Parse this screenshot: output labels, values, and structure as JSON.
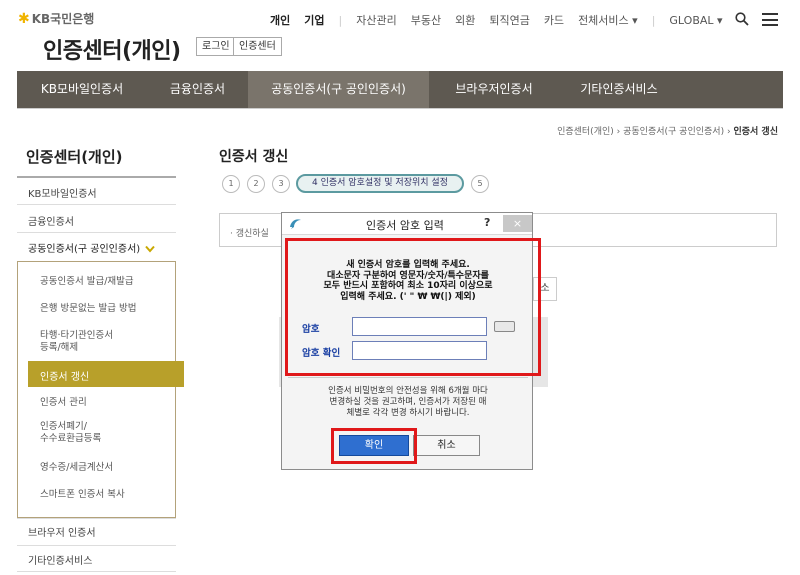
{
  "header": {
    "logo_text": "KB국민은행",
    "title": "인증센터(개인)",
    "login_label": "로그인",
    "cert_center_label": "인증센터",
    "nav": [
      "개인",
      "기업",
      "자산관리",
      "부동산",
      "외환",
      "퇴직연금",
      "카드",
      "전체서비스 ▾",
      "GLOBAL ▾"
    ]
  },
  "mainnav": [
    "KB모바일인증서",
    "금융인증서",
    "공동인증서(구 공인인증서)",
    "브라우저인증서",
    "기타인증서비스"
  ],
  "breadcrumb": {
    "items": [
      "인증센터(개인)",
      "공동인증서(구 공인인증서)"
    ],
    "current": "인증서 갱신",
    "separator": "›"
  },
  "sidebar": {
    "title": "인증센터(개인)",
    "items": [
      "KB모바일인증서",
      "금융인증서",
      "공동인증서(구 공인인증서)",
      "브라우저 인증서",
      "기타인증서비스"
    ],
    "sub_items": [
      "공동인증서 발급/재발급",
      "은행 방문없는 발급 방법",
      "타행·타기관인증서",
      "등록/해제",
      "인증서 갱신",
      "인증서 관리",
      "인증서폐기/",
      "수수료환급등록",
      "영수증/세금계산서",
      "스마트폰 인증서 복사"
    ]
  },
  "content": {
    "title": "인증서 갱신",
    "steps": [
      "1",
      "2",
      "3",
      "5"
    ],
    "active_step": "4 인증서 암호설정 및 저장위치 설정",
    "box_text": "· 갱신하실",
    "bg_button": "소"
  },
  "dialog": {
    "title": "인증서 암호 입력",
    "help": "?",
    "close": "×",
    "message_lines": [
      "새 인증서 암호를 입력해 주세요.",
      "대소문자 구분하여 영문자/숫자/특수문자를",
      "모두 반드시 포함하여 최소 10자리 이상으로",
      "입력해 주세요. (' \" ₩ ₩(|) 제외)"
    ],
    "password_label": "암호",
    "confirm_label": "암호 확인",
    "password_value": "",
    "confirm_value": "",
    "note_lines": [
      "인증서 비밀번호의 안전성을 위해 6개월 마다",
      "변경하실 것을 권고하며, 인증서가 저장된 매",
      "체별로 각각 변경 하시기 바랍니다."
    ],
    "ok_label": "확인",
    "cancel_label": "취소"
  },
  "colors": {
    "nav_bg": "#5e5951",
    "accent_gold": "#b8a02a",
    "highlight_red": "#e0181a",
    "ok_blue": "#2f6fd0"
  }
}
